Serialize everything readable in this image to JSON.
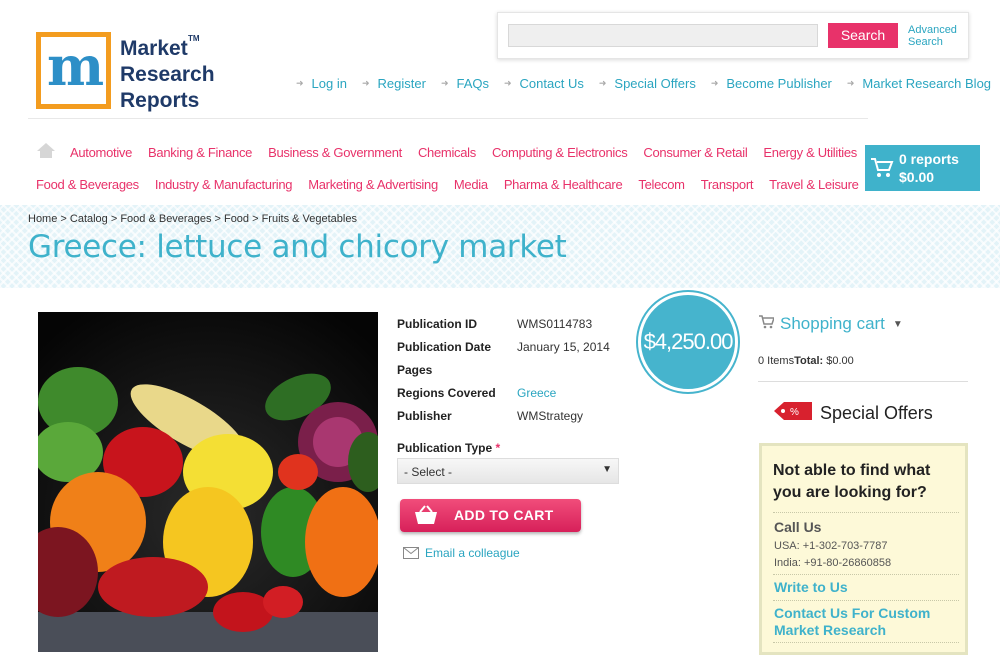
{
  "logo": {
    "lines": [
      "Market",
      "Research",
      "Reports"
    ],
    "tm": "TM"
  },
  "search": {
    "button_label": "Search",
    "advanced_label_1": "Advanced",
    "advanced_label_2": "Search",
    "placeholder": ""
  },
  "top_links": [
    "Log in",
    "Register",
    "FAQs",
    "Contact Us",
    "Special Offers",
    "Become Publisher",
    "Market Research Blog"
  ],
  "categories_row1": [
    "Automotive",
    "Banking & Finance",
    "Business & Government",
    "Chemicals",
    "Computing & Electronics",
    "Consumer & Retail",
    "Energy & Utilities"
  ],
  "categories_row2": [
    "Food & Beverages",
    "Industry & Manufacturing",
    "Marketing & Advertising",
    "Media",
    "Pharma & Healthcare",
    "Telecom",
    "Transport",
    "Travel & Leisure"
  ],
  "cart": {
    "reports": "0 reports",
    "total": "$0.00"
  },
  "breadcrumb": "Home > Catalog > Food & Beverages > Food > Fruits & Vegetables",
  "page_title": "Greece: lettuce and chicory market",
  "details": {
    "pub_id_label": "Publication ID",
    "pub_id": "WMS0114783",
    "pub_date_label": "Publication Date",
    "pub_date": "January 15, 2014",
    "pages_label": "Pages",
    "pages": "",
    "regions_label": "Regions Covered",
    "regions": "Greece",
    "publisher_label": "Publisher",
    "publisher": "WMStrategy"
  },
  "publication_type": {
    "label": "Publication Type",
    "required": "*",
    "selected": "- Select -"
  },
  "add_to_cart": "ADD TO CART",
  "email_colleague": "Email a colleague",
  "price": "$4,250.00",
  "shopping_cart": {
    "title": "Shopping cart",
    "items": "0 Items",
    "total_label": "Total:",
    "total": "$0.00"
  },
  "special_offers": "Special Offers",
  "help": {
    "question": "Not able to find what you are looking for?",
    "call_us": "Call Us",
    "usa": "USA: +1-302-703-7787",
    "india": "India: +91-80-26860858",
    "write_to_us": "Write to Us",
    "custom": "Contact Us For Custom Market Research"
  },
  "colors": {
    "accent_pink": "#e8326a",
    "accent_blue": "#3fb2cb"
  }
}
